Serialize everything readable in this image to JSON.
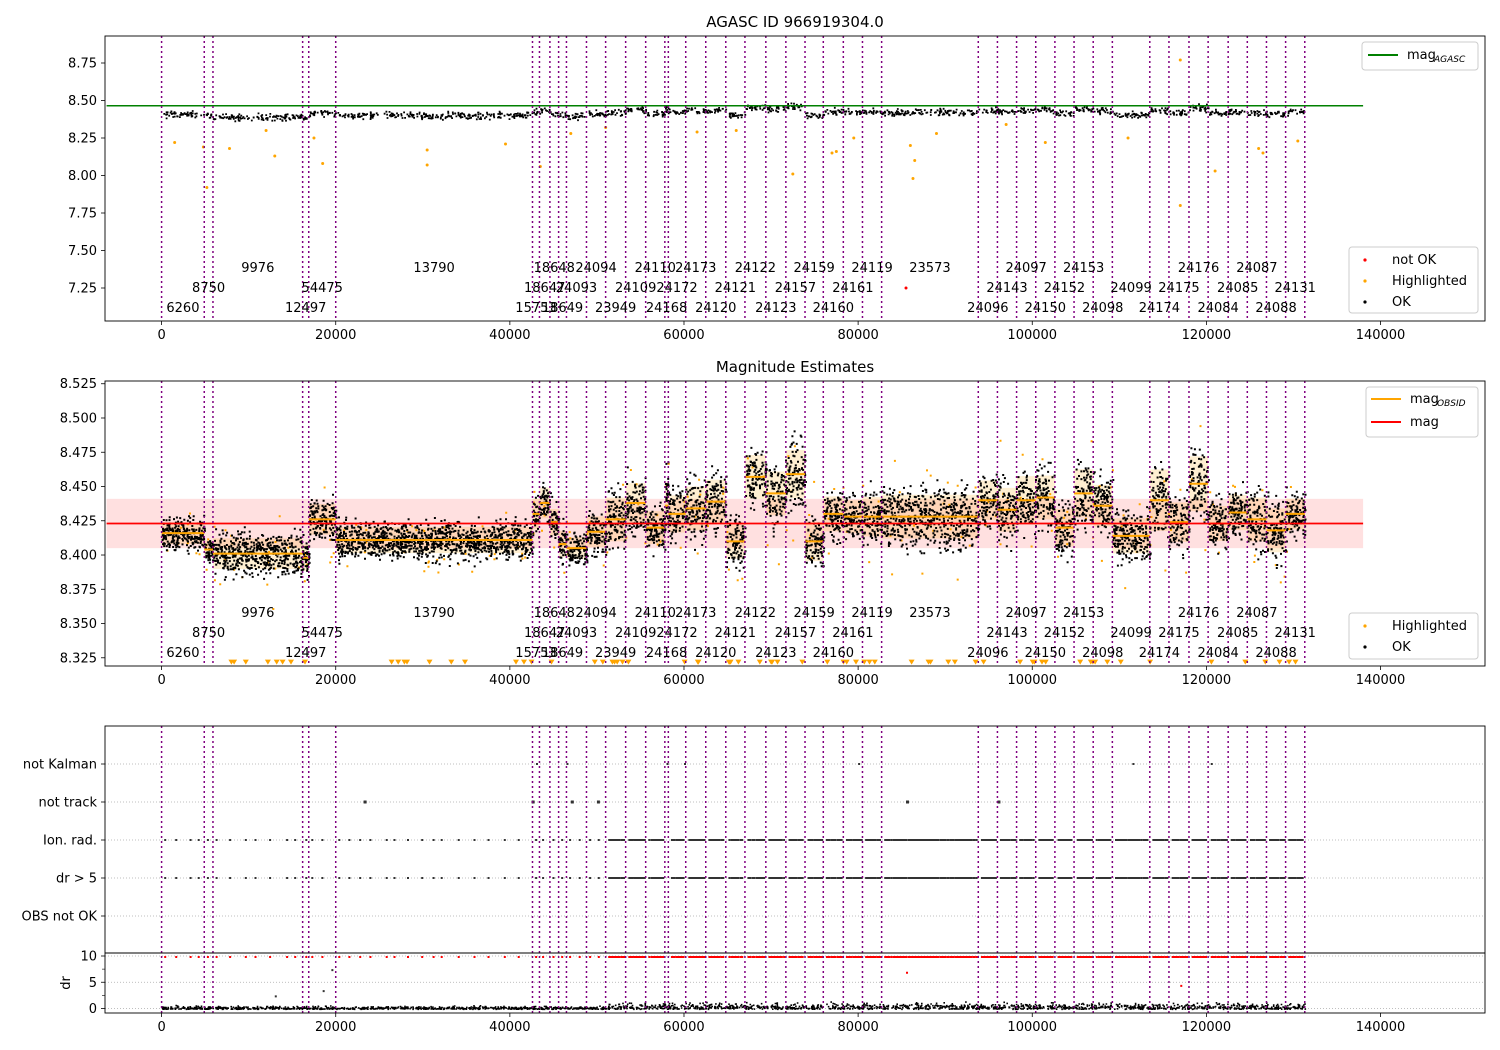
{
  "chart_data": [
    {
      "id": "agasc",
      "type": "scatter",
      "title": "AGASC ID 966919304.0",
      "xlim": [
        -6500,
        152000
      ],
      "ylim": [
        7.03,
        8.93
      ],
      "xticks": [
        0,
        20000,
        40000,
        60000,
        80000,
        100000,
        120000,
        140000
      ],
      "yticks": [
        7.25,
        7.5,
        7.75,
        8.0,
        8.25,
        8.5,
        8.75
      ],
      "ytick_labels": [
        "7.25",
        "7.50",
        "7.75",
        "8.00",
        "8.25",
        "8.50",
        "8.75"
      ],
      "mag_agasc": 8.465,
      "lines_legend": [
        {
          "main": "mag",
          "sub": "AGASC",
          "color": "#008000"
        }
      ],
      "points_legend": [
        {
          "label": "not OK",
          "color": "#ff0000"
        },
        {
          "label": "Highlighted",
          "color": "#ffa500"
        },
        {
          "label": "OK",
          "color": "#000000"
        }
      ],
      "outliers": [
        {
          "x": 1500,
          "y": 8.22
        },
        {
          "x": 4800,
          "y": 8.19
        },
        {
          "x": 5200,
          "y": 7.92
        },
        {
          "x": 7800,
          "y": 8.18
        },
        {
          "x": 12000,
          "y": 8.3
        },
        {
          "x": 13000,
          "y": 8.13
        },
        {
          "x": 17500,
          "y": 8.25
        },
        {
          "x": 18500,
          "y": 8.08
        },
        {
          "x": 30500,
          "y": 8.07
        },
        {
          "x": 30500,
          "y": 8.17
        },
        {
          "x": 39500,
          "y": 8.21
        },
        {
          "x": 43500,
          "y": 8.06
        },
        {
          "x": 47000,
          "y": 8.28
        },
        {
          "x": 51000,
          "y": 8.32
        },
        {
          "x": 61500,
          "y": 8.29
        },
        {
          "x": 66000,
          "y": 8.3
        },
        {
          "x": 72500,
          "y": 8.01
        },
        {
          "x": 77000,
          "y": 8.15
        },
        {
          "x": 77500,
          "y": 8.16
        },
        {
          "x": 79500,
          "y": 8.25
        },
        {
          "x": 86000,
          "y": 8.2
        },
        {
          "x": 86500,
          "y": 8.1
        },
        {
          "x": 86300,
          "y": 7.98
        },
        {
          "x": 89000,
          "y": 8.28
        },
        {
          "x": 97000,
          "y": 8.34
        },
        {
          "x": 101500,
          "y": 8.22
        },
        {
          "x": 111000,
          "y": 8.25
        },
        {
          "x": 117000,
          "y": 8.77
        },
        {
          "x": 117000,
          "y": 7.8
        },
        {
          "x": 121000,
          "y": 8.03
        },
        {
          "x": 126000,
          "y": 8.18
        },
        {
          "x": 126500,
          "y": 8.15
        },
        {
          "x": 130500,
          "y": 8.23
        }
      ],
      "not_ok_points": [
        {
          "x": 85500,
          "y": 7.25
        }
      ]
    },
    {
      "id": "estimates",
      "type": "scatter",
      "title": "Magnitude Estimates",
      "xlim": [
        -6500,
        152000
      ],
      "ylim": [
        8.319,
        8.527
      ],
      "xticks": [
        0,
        20000,
        40000,
        60000,
        80000,
        100000,
        120000,
        140000
      ],
      "yticks": [
        8.325,
        8.35,
        8.375,
        8.4,
        8.425,
        8.45,
        8.475,
        8.5,
        8.525
      ],
      "ytick_labels": [
        "8.325",
        "8.350",
        "8.375",
        "8.400",
        "8.425",
        "8.450",
        "8.475",
        "8.500",
        "8.525"
      ],
      "mag": 8.423,
      "mag_band": [
        8.405,
        8.441
      ],
      "lines_legend": [
        {
          "main": "mag",
          "sub": "OBSID",
          "color": "#ffa500"
        },
        {
          "main": "mag",
          "sub": "",
          "color": "#ff0000"
        }
      ],
      "points_legend": [
        {
          "label": "Highlighted",
          "color": "#ffa500"
        },
        {
          "label": "OK",
          "color": "#000000"
        }
      ]
    },
    {
      "id": "flags",
      "type": "scatter",
      "xlim": [
        -6500,
        152000
      ],
      "xticks": [
        0,
        20000,
        40000,
        60000,
        80000,
        100000,
        120000,
        140000
      ],
      "flag_rows": [
        "not Kalman",
        "not track",
        "Ion. rad.",
        "dr > 5",
        "OBS not OK"
      ],
      "not_kalman_x": [
        43000,
        46500,
        58000,
        60000,
        80000,
        111500,
        120500
      ],
      "not_track_x": [
        23200,
        42500,
        47000,
        50000,
        85500,
        96000
      ],
      "dr_ylabel": "dr",
      "dr_yticks": [
        0,
        5,
        10
      ],
      "dr_ylim": [
        -0.5,
        10.5
      ]
    }
  ],
  "obsids": [
    {
      "label": "6260",
      "start": 0,
      "end": 4900,
      "tier": 0
    },
    {
      "label": "8750",
      "start": 4900,
      "end": 5900,
      "tier": 1
    },
    {
      "label": "9976",
      "start": 5900,
      "end": 16200,
      "tier": 2
    },
    {
      "label": "12497",
      "start": 16200,
      "end": 16900,
      "tier": 0
    },
    {
      "label": "54475",
      "start": 16900,
      "end": 20000,
      "tier": 1
    },
    {
      "label": "13790",
      "start": 20000,
      "end": 42600,
      "tier": 2
    },
    {
      "label": "15753",
      "start": 42600,
      "end": 43400,
      "tier": 0
    },
    {
      "label": "18647",
      "start": 43400,
      "end": 44600,
      "tier": 1
    },
    {
      "label": "18648",
      "start": 44600,
      "end": 45600,
      "tier": 2
    },
    {
      "label": "18649",
      "start": 45600,
      "end": 46500,
      "tier": 0
    },
    {
      "label": "24093",
      "start": 46500,
      "end": 48800,
      "tier": 1
    },
    {
      "label": "24094",
      "start": 48800,
      "end": 51000,
      "tier": 2
    },
    {
      "label": "23949",
      "start": 51000,
      "end": 53300,
      "tier": 0
    },
    {
      "label": "24109",
      "start": 53300,
      "end": 55600,
      "tier": 1
    },
    {
      "label": "24110",
      "start": 55600,
      "end": 57800,
      "tier": 2
    },
    {
      "label": "24168",
      "start": 57800,
      "end": 58200,
      "tier": 0
    },
    {
      "label": "24172",
      "start": 58200,
      "end": 60200,
      "tier": 1
    },
    {
      "label": "24173",
      "start": 60200,
      "end": 62500,
      "tier": 2
    },
    {
      "label": "24120",
      "start": 62500,
      "end": 64800,
      "tier": 0
    },
    {
      "label": "24121",
      "start": 64800,
      "end": 67000,
      "tier": 1
    },
    {
      "label": "24122",
      "start": 67000,
      "end": 69400,
      "tier": 2
    },
    {
      "label": "24123",
      "start": 69400,
      "end": 71700,
      "tier": 0
    },
    {
      "label": "24157",
      "start": 71700,
      "end": 73900,
      "tier": 1
    },
    {
      "label": "24159",
      "start": 73900,
      "end": 76000,
      "tier": 2
    },
    {
      "label": "24160",
      "start": 76000,
      "end": 78300,
      "tier": 0
    },
    {
      "label": "24161",
      "start": 78300,
      "end": 80500,
      "tier": 1
    },
    {
      "label": "24119",
      "start": 80500,
      "end": 82700,
      "tier": 2
    },
    {
      "label": "23573",
      "start": 82700,
      "end": 93800,
      "tier": 2
    },
    {
      "label": "24096",
      "start": 93800,
      "end": 96000,
      "tier": 0
    },
    {
      "label": "24143",
      "start": 96000,
      "end": 98200,
      "tier": 1
    },
    {
      "label": "24097",
      "start": 98200,
      "end": 100400,
      "tier": 2
    },
    {
      "label": "24150",
      "start": 100400,
      "end": 102600,
      "tier": 0
    },
    {
      "label": "24152",
      "start": 102600,
      "end": 104800,
      "tier": 1
    },
    {
      "label": "24153",
      "start": 104800,
      "end": 107000,
      "tier": 2
    },
    {
      "label": "24098",
      "start": 107000,
      "end": 109200,
      "tier": 0
    },
    {
      "label": "24099",
      "start": 109200,
      "end": 113500,
      "tier": 1
    },
    {
      "label": "24174",
      "start": 113500,
      "end": 115700,
      "tier": 0
    },
    {
      "label": "24175",
      "start": 115700,
      "end": 118000,
      "tier": 1
    },
    {
      "label": "24176",
      "start": 118000,
      "end": 120200,
      "tier": 2
    },
    {
      "label": "24084",
      "start": 120200,
      "end": 122500,
      "tier": 0
    },
    {
      "label": "24085",
      "start": 122500,
      "end": 124700,
      "tier": 1
    },
    {
      "label": "24087",
      "start": 124700,
      "end": 126900,
      "tier": 2
    },
    {
      "label": "24088",
      "start": 126900,
      "end": 129100,
      "tier": 0
    },
    {
      "label": "24131",
      "start": 129100,
      "end": 131300,
      "tier": 1
    }
  ],
  "mag_obsid_levels": [
    8.416,
    8.404,
    8.401,
    8.398,
    8.426,
    8.411,
    8.43,
    8.438,
    8.424,
    8.408,
    8.405,
    8.417,
    8.426,
    8.438,
    8.42,
    8.436,
    8.43,
    8.434,
    8.439,
    8.41,
    8.457,
    8.445,
    8.459,
    8.41,
    8.43,
    8.428,
    8.428,
    8.428,
    8.44,
    8.433,
    8.44,
    8.442,
    8.42,
    8.445,
    8.436,
    8.414,
    8.44,
    8.424,
    8.452,
    8.423,
    8.431,
    8.426,
    8.418,
    8.43
  ],
  "band_halfwidths": [
    0.01,
    0.008,
    0.014,
    0.012,
    0.014,
    0.012,
    0.014,
    0.014,
    0.012,
    0.012,
    0.01,
    0.014,
    0.02,
    0.018,
    0.015,
    0.022,
    0.017,
    0.02,
    0.02,
    0.016,
    0.02,
    0.02,
    0.022,
    0.018,
    0.016,
    0.015,
    0.018,
    0.02,
    0.018,
    0.02,
    0.022,
    0.02,
    0.017,
    0.022,
    0.019,
    0.016,
    0.028,
    0.018,
    0.025,
    0.016,
    0.016,
    0.02,
    0.02,
    0.014
  ]
}
